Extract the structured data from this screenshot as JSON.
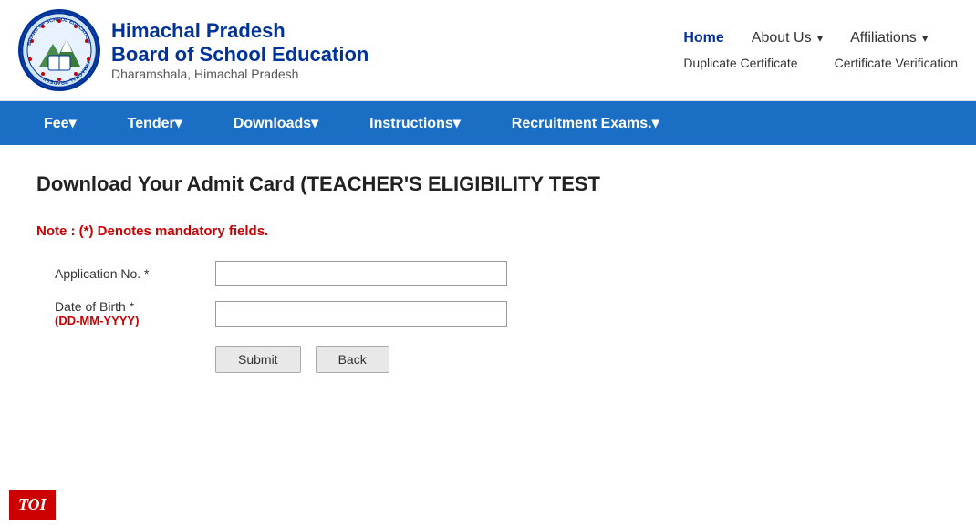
{
  "header": {
    "org_line1": "Himachal Pradesh",
    "org_line2": "Board of School Education",
    "org_location": "Dharamshala, Himachal Pradesh",
    "nav_row1": {
      "home": "Home",
      "about_us": "About Us",
      "about_us_arrow": "▾",
      "affiliations": "Affiliations",
      "affiliations_arrow": "▾"
    },
    "nav_row2": {
      "duplicate_cert": "Duplicate Certificate",
      "cert_verification": "Certificate Verification"
    }
  },
  "blue_nav": {
    "items": [
      {
        "label": "Fee",
        "arrow": "▾"
      },
      {
        "label": "Tender",
        "arrow": "▾"
      },
      {
        "label": "Downloads",
        "arrow": "▾"
      },
      {
        "label": "Instructions",
        "arrow": "▾"
      },
      {
        "label": "Recruitment Exams.",
        "arrow": "▾"
      }
    ]
  },
  "main": {
    "page_title": "Download Your Admit Card (TEACHER'S ELIGIBILITY TEST",
    "note": "Note  : (*) Denotes mandatory fields.",
    "form": {
      "app_no_label": "Application No. *",
      "dob_label": "Date of Birth *",
      "dob_format": "(DD-MM-YYYY)",
      "app_no_placeholder": "",
      "dob_placeholder": "",
      "submit_label": "Submit",
      "back_label": "Back"
    }
  },
  "toi": {
    "label": "TOI"
  }
}
